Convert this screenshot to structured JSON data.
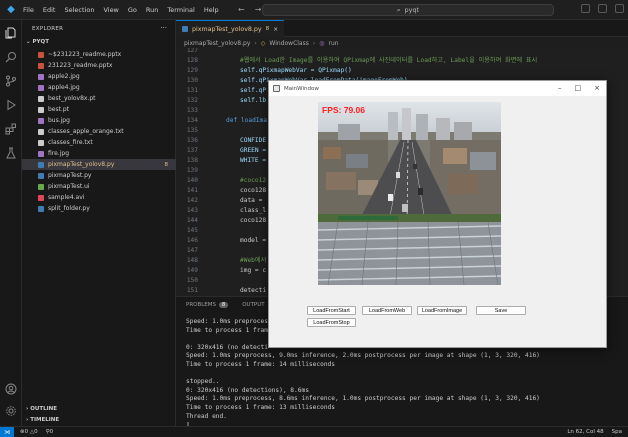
{
  "menu": [
    "File",
    "Edit",
    "Selection",
    "View",
    "Go",
    "Run",
    "Terminal",
    "Help"
  ],
  "search": {
    "text": "pyqt"
  },
  "sidebar": {
    "title": "EXPLORER",
    "folder": "PYQT",
    "files": [
      {
        "name": "~$231223_readme.pptx",
        "color": "#c9523d"
      },
      {
        "name": "231223_readme.pptx",
        "color": "#c9523d"
      },
      {
        "name": "apple2.jpg",
        "color": "#a074c4"
      },
      {
        "name": "apple4.jpg",
        "color": "#a074c4"
      },
      {
        "name": "best_yolov8x.pt",
        "color": "#cccccc"
      },
      {
        "name": "best.pt",
        "color": "#cccccc"
      },
      {
        "name": "bus.jpg",
        "color": "#a074c4"
      },
      {
        "name": "classes_apple_orange.txt",
        "color": "#cccccc"
      },
      {
        "name": "classes_fire.txt",
        "color": "#cccccc"
      },
      {
        "name": "fire.jpg",
        "color": "#a074c4"
      },
      {
        "name": "pixmapTest_yolov8.py",
        "color": "#3f7cb3",
        "active": true,
        "badge": "8"
      },
      {
        "name": "pixmapTest.py",
        "color": "#3f7cb3"
      },
      {
        "name": "pixmapTest.ui",
        "color": "#6aa84f"
      },
      {
        "name": "sample4.avi",
        "color": "#e0475b"
      },
      {
        "name": "split_folder.py",
        "color": "#3f7cb3"
      }
    ],
    "outline": "OUTLINE",
    "timeline": "TIMELINE"
  },
  "tab": {
    "name": "pixmapTest_yolov8.py",
    "badge": "8"
  },
  "breadcrumb": {
    "file": "pixmapTest_yolov8.py",
    "cls": "WindowClass",
    "fn": "run"
  },
  "code": [
    {
      "ln": "127",
      "text": ""
    },
    {
      "ln": "128",
      "text": "#웹에서 Load한 Image를 이용하여 QPixmap에 사진데이터를 Load하고, Label을 이용하여 화면에 표시"
    },
    {
      "ln": "129",
      "text": "self.qPixmapWebVar = QPixmap()"
    },
    {
      "ln": "130",
      "text": "self.qPixmapWebVar.loadFromData(imageFromWeb)"
    },
    {
      "ln": "131",
      "text": "self.qP"
    },
    {
      "ln": "132",
      "text": "self.lb"
    },
    {
      "ln": "133",
      "text": ""
    },
    {
      "ln": "134",
      "text": "def loadIma"
    },
    {
      "ln": "135",
      "text": ""
    },
    {
      "ln": "136",
      "text": "CONFIDE"
    },
    {
      "ln": "137",
      "text": "GREEN ="
    },
    {
      "ln": "138",
      "text": "WHITE ="
    },
    {
      "ln": "139",
      "text": ""
    },
    {
      "ln": "140",
      "text": "#coco12"
    },
    {
      "ln": "141",
      "text": "coco128"
    },
    {
      "ln": "142",
      "text": "data ="
    },
    {
      "ln": "143",
      "text": "class_l"
    },
    {
      "ln": "144",
      "text": "coco128"
    },
    {
      "ln": "145",
      "text": ""
    },
    {
      "ln": "146",
      "text": "model ="
    },
    {
      "ln": "147",
      "text": ""
    },
    {
      "ln": "148",
      "text": "#Web에서"
    },
    {
      "ln": "149",
      "text": "img = c"
    },
    {
      "ln": "150",
      "text": ""
    },
    {
      "ln": "151",
      "text": "detecti"
    },
    {
      "ln": "152",
      "text": ""
    }
  ],
  "panel": {
    "tab_problems": "PROBLEMS",
    "problems_count": "8",
    "tab_output": "OUTPUT",
    "terminal": [
      "Speed: 1.0ms preproces",
      "Time to process 1 fram",
      "",
      "0: 320x416 (no detecti",
      "Speed: 1.0ms preprocess, 9.0ms inference, 2.0ms postprocess per image at shape (1, 3, 320, 416)",
      "Time to process 1 frame: 14 milliseconds",
      "",
      "stopped..",
      "0: 320x416 (no detections), 8.6ms",
      "Speed: 1.0ms preprocess, 8.6ms inference, 1.0ms postprocess per image at shape (1, 3, 320, 416)",
      "Time to process 1 frame: 13 milliseconds",
      "Thread end.",
      "▯"
    ]
  },
  "status": {
    "errors": "0",
    "warnings": "0",
    "info": "0",
    "position": "Ln 62, Col 48",
    "spaces": "Spa"
  },
  "qt": {
    "title": "MainWindow",
    "fps": "FPS: 79.06",
    "buttons": {
      "load_start": "LoadFromStart",
      "load_web": "LoadFromWeb",
      "load_image": "LoadFromImage",
      "save": "Save",
      "load_stop": "LoadFromStop"
    }
  }
}
